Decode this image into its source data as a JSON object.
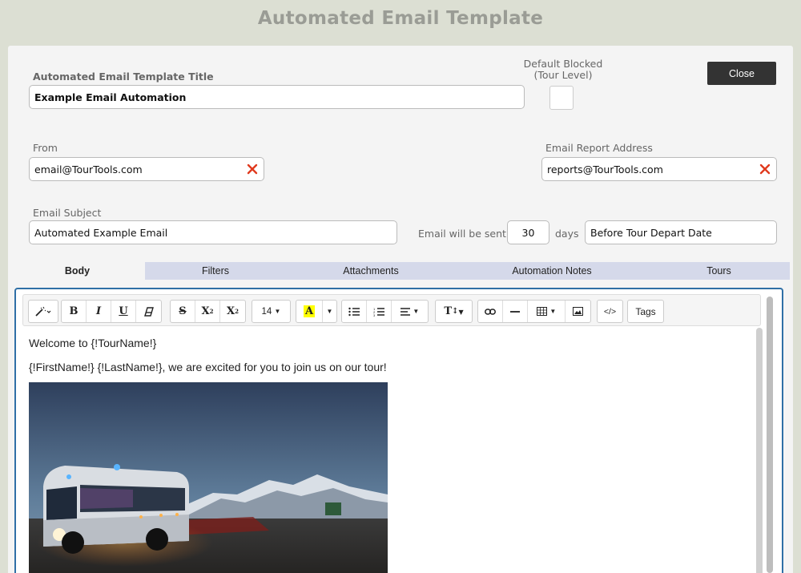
{
  "page": {
    "title": "Automated Email Template"
  },
  "form": {
    "title_label": "Automated Email Template Title",
    "title_value": "Example Email Automation",
    "default_blocked_label": "Default Blocked\n(Tour Level)",
    "default_blocked_checked": false,
    "close_label": "Close",
    "from_label": "From",
    "from_value": "email@TourTools.com",
    "report_label": "Email Report Address",
    "report_value": "reports@TourTools.com",
    "subject_label": "Email Subject",
    "subject_value": "Automated Example Email",
    "sent_label": "Email will be sent",
    "days_value": "30",
    "days_label": "days",
    "timing_value": "Before Tour Depart Date"
  },
  "tabs": [
    {
      "label": "Body",
      "active": true
    },
    {
      "label": "Filters",
      "active": false
    },
    {
      "label": "Attachments",
      "active": false
    },
    {
      "label": "Automation Notes",
      "active": false
    },
    {
      "label": "Tours",
      "active": false
    }
  ],
  "toolbar": {
    "magic_icon": "magic-wand-icon",
    "bold": "B",
    "italic": "I",
    "underline": "U",
    "eraser_icon": "eraser-icon",
    "strike": "S",
    "superscript": "X",
    "subscript": "X",
    "font_size": "14",
    "highlight": "A",
    "highlight_color": "#ffff00",
    "ul_icon": "unordered-list-icon",
    "ol_icon": "ordered-list-icon",
    "align_icon": "align-icon",
    "text_style": "T",
    "link_icon": "link-icon",
    "hr_icon": "horizontal-rule-icon",
    "table_icon": "table-icon",
    "image_icon": "image-icon",
    "code_view": "</>",
    "tags": "Tags"
  },
  "content": {
    "line1": "Welcome to {!TourName!}",
    "line2": "{!FirstName!} {!LastName!}, we are excited for you to join us on our tour!",
    "image_alt": "bus-photo"
  },
  "colors": {
    "accent": "#2f6fa6",
    "clear_x": "#e03a1e",
    "close_bg": "#333333",
    "tab_bg": "#d5d9ea"
  }
}
